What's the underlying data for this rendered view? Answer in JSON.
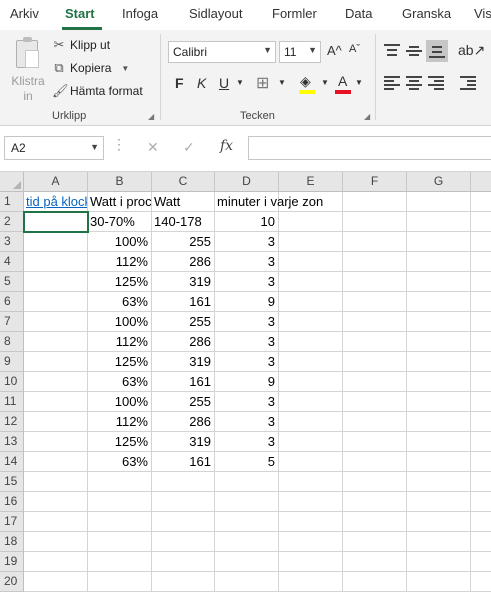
{
  "ribbon_tabs": [
    "Arkiv",
    "Start",
    "Infoga",
    "Sidlayout",
    "Formler",
    "Data",
    "Granska",
    "Vis"
  ],
  "active_tab": "Start",
  "clipboard": {
    "paste_label": "Klistra in",
    "cut_label": "Klipp ut",
    "copy_label": "Kopiera",
    "format_painter_label": "Hämta format",
    "group_label": "Urklipp"
  },
  "font": {
    "name": "Calibri",
    "size": "11",
    "bold": "F",
    "italic": "K",
    "underline": "U",
    "font_color_glyph": "A",
    "grow_glyph": "A^",
    "shrink_glyph": "Aˇ",
    "group_label": "Tecken"
  },
  "formula_bar": {
    "name_box": "A2",
    "cancel": "✕",
    "enter": "✓",
    "fx": "fx",
    "value": ""
  },
  "columns": [
    "A",
    "B",
    "C",
    "D",
    "E",
    "F",
    "G"
  ],
  "rows": [
    "1",
    "2",
    "3",
    "4",
    "5",
    "6",
    "7",
    "8",
    "9",
    "10",
    "11",
    "12",
    "13",
    "14",
    "15",
    "16",
    "17",
    "18",
    "19",
    "20"
  ],
  "cells": {
    "A1": "tid på klockan",
    "B1": "Watt i procent",
    "C1": "Watt",
    "D1": "minuter i varje zon",
    "B2": "30-70%",
    "C2": "140-178",
    "D2": "10"
  },
  "data_rows": [
    {
      "row": "3",
      "b": "100%",
      "c": "255",
      "d": "3"
    },
    {
      "row": "4",
      "b": "112%",
      "c": "286",
      "d": "3"
    },
    {
      "row": "5",
      "b": "125%",
      "c": "319",
      "d": "3"
    },
    {
      "row": "6",
      "b": "63%",
      "c": "161",
      "d": "9"
    },
    {
      "row": "7",
      "b": "100%",
      "c": "255",
      "d": "3"
    },
    {
      "row": "8",
      "b": "112%",
      "c": "286",
      "d": "3"
    },
    {
      "row": "9",
      "b": "125%",
      "c": "319",
      "d": "3"
    },
    {
      "row": "10",
      "b": "63%",
      "c": "161",
      "d": "9"
    },
    {
      "row": "11",
      "b": "100%",
      "c": "255",
      "d": "3"
    },
    {
      "row": "12",
      "b": "112%",
      "c": "286",
      "d": "3"
    },
    {
      "row": "13",
      "b": "125%",
      "c": "319",
      "d": "3"
    },
    {
      "row": "14",
      "b": "63%",
      "c": "161",
      "d": "5"
    }
  ],
  "colors": {
    "accent": "#217346",
    "hyperlink": "#0563c1",
    "font_color_bar": "#e81123",
    "highlight_bar": "#ffff00"
  }
}
